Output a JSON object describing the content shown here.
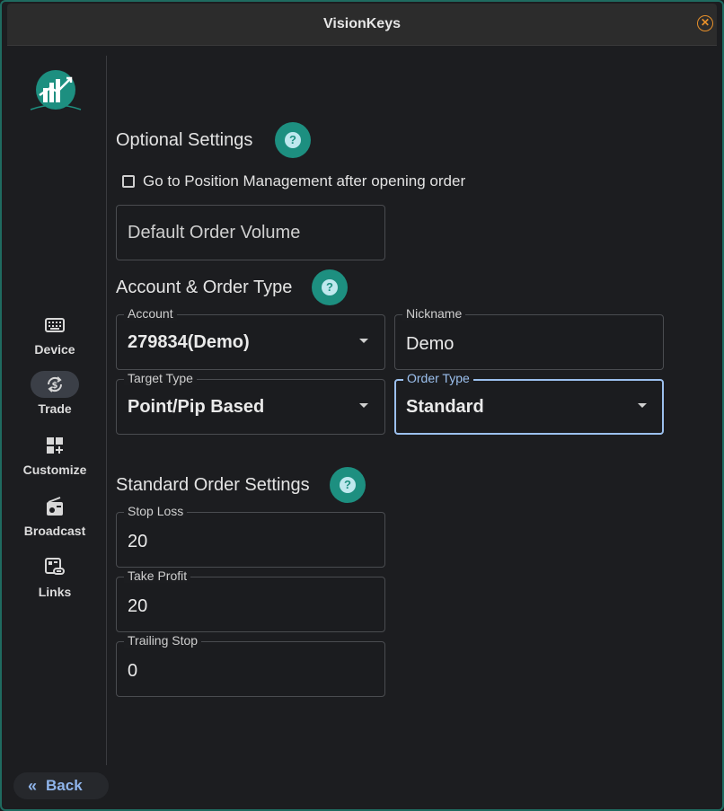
{
  "window": {
    "title": "VisionKeys"
  },
  "sidebar": {
    "items": [
      {
        "label": "Device",
        "icon": "keyboard-icon"
      },
      {
        "label": "Trade",
        "icon": "sync-dollar-icon",
        "active": true
      },
      {
        "label": "Customize",
        "icon": "dashboard-add-icon"
      },
      {
        "label": "Broadcast",
        "icon": "radio-icon"
      },
      {
        "label": "Links",
        "icon": "link-card-icon"
      }
    ],
    "back_label": "Back"
  },
  "optional": {
    "title": "Optional Settings",
    "checkbox_label": "Go to Position Management after opening order",
    "checkbox_checked": false,
    "default_volume_placeholder": "Default Order Volume"
  },
  "account_order": {
    "title": "Account & Order Type",
    "account_label": "Account",
    "account_value": "279834(Demo)",
    "nickname_label": "Nickname",
    "nickname_value": "Demo",
    "target_type_label": "Target Type",
    "target_type_value": "Point/Pip Based",
    "order_type_label": "Order Type",
    "order_type_value": "Standard"
  },
  "standard": {
    "title": "Standard Order Settings",
    "stop_loss_label": "Stop Loss",
    "stop_loss_value": "20",
    "take_profit_label": "Take Profit",
    "take_profit_value": "20",
    "trailing_stop_label": "Trailing Stop",
    "trailing_stop_value": "0"
  },
  "colors": {
    "accent": "#1d8f80",
    "focus": "#9cc0ee",
    "close": "#e8902a"
  }
}
